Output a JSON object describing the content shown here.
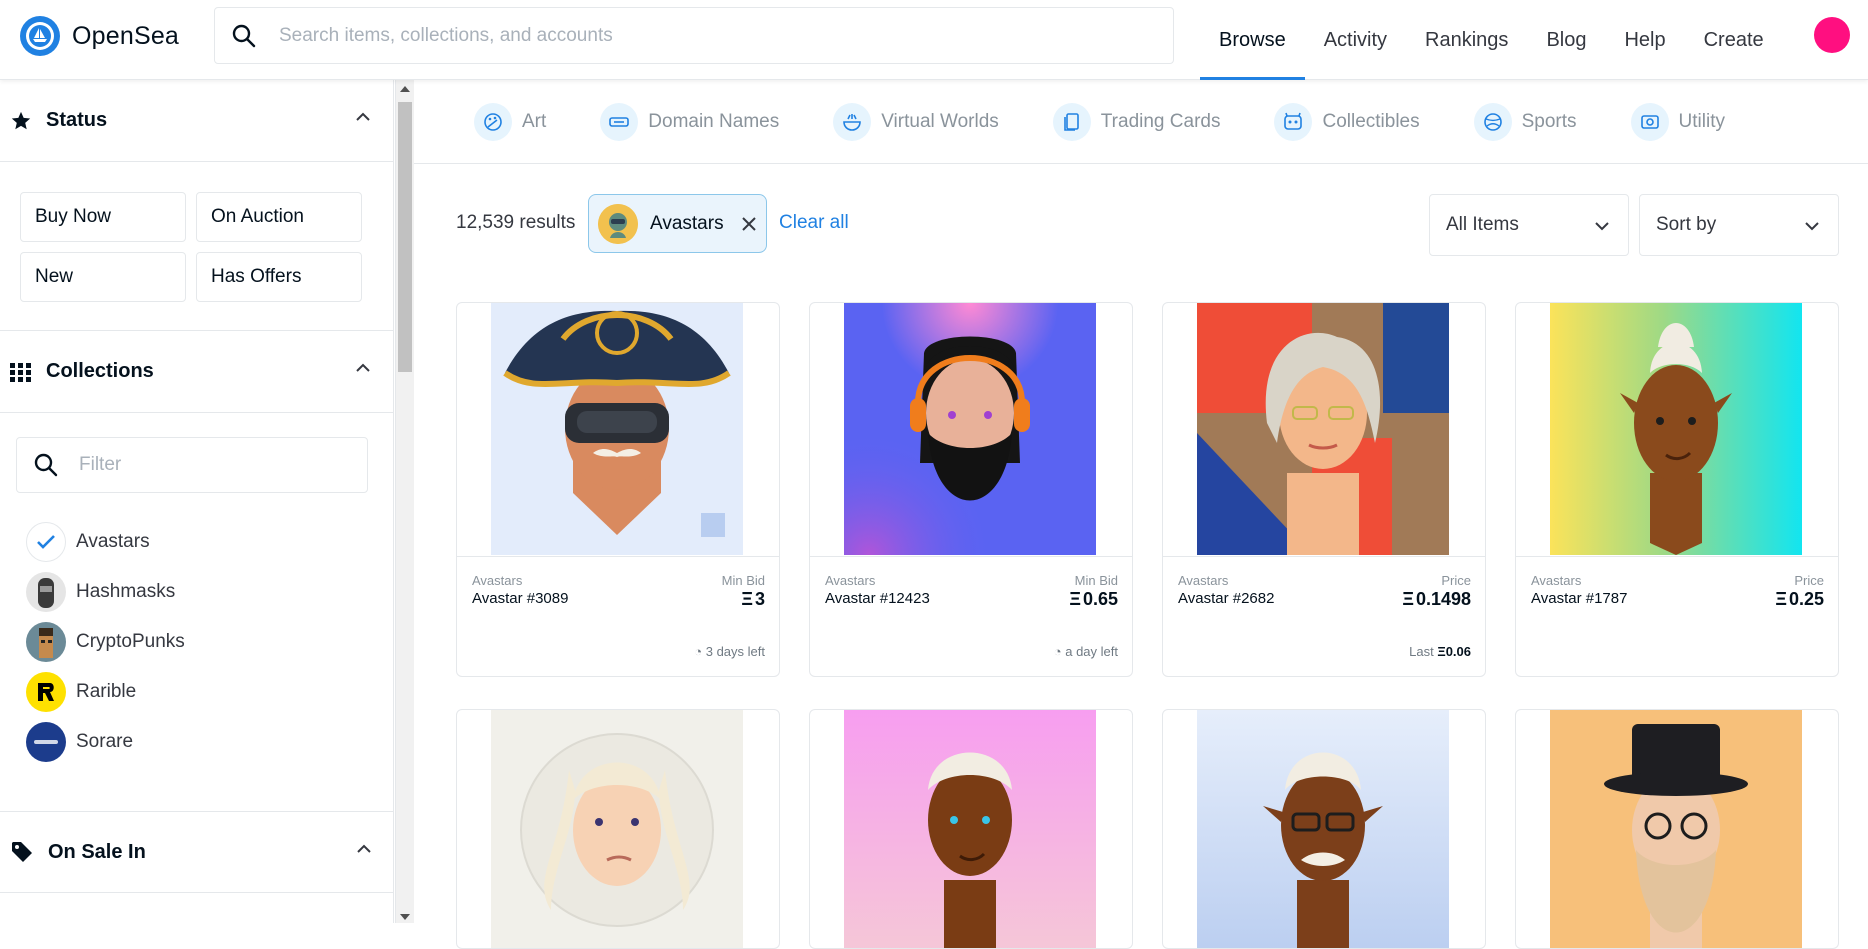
{
  "brand": {
    "name": "OpenSea"
  },
  "search": {
    "placeholder": "Search items, collections, and accounts"
  },
  "nav": {
    "links": [
      "Browse",
      "Activity",
      "Rankings",
      "Blog",
      "Help",
      "Create"
    ],
    "active": "Browse"
  },
  "sidebar": {
    "status": {
      "title": "Status",
      "buttons": [
        "Buy Now",
        "On Auction",
        "New",
        "Has Offers"
      ]
    },
    "collections": {
      "title": "Collections",
      "filter_placeholder": "Filter",
      "items": [
        {
          "name": "Avastars",
          "checked": true
        },
        {
          "name": "Hashmasks"
        },
        {
          "name": "CryptoPunks"
        },
        {
          "name": "Rarible"
        },
        {
          "name": "Sorare"
        }
      ]
    },
    "on_sale": {
      "title": "On Sale In"
    }
  },
  "categories": [
    "Art",
    "Domain Names",
    "Virtual Worlds",
    "Trading Cards",
    "Collectibles",
    "Sports",
    "Utility"
  ],
  "results": {
    "count": "12,539 results",
    "chip": "Avastars",
    "clear_all": "Clear all",
    "filter_select": "All Items",
    "sort_select": "Sort by"
  },
  "cards": [
    {
      "collection": "Avastars",
      "name": "Avastar #3089",
      "price_label": "Min Bid",
      "price": "3",
      "footer": "3 days left"
    },
    {
      "collection": "Avastars",
      "name": "Avastar #12423",
      "price_label": "Min Bid",
      "price": "0.65",
      "footer": "a day left"
    },
    {
      "collection": "Avastars",
      "name": "Avastar #2682",
      "price_label": "Price",
      "price": "0.1498",
      "footer_label": "Last",
      "footer_value": "0.06"
    },
    {
      "collection": "Avastars",
      "name": "Avastar #1787",
      "price_label": "Price",
      "price": "0.25"
    }
  ],
  "eth_symbol": "Ξ",
  "colors": {
    "accent": "#2081e2",
    "profile": "#ff0f80"
  }
}
